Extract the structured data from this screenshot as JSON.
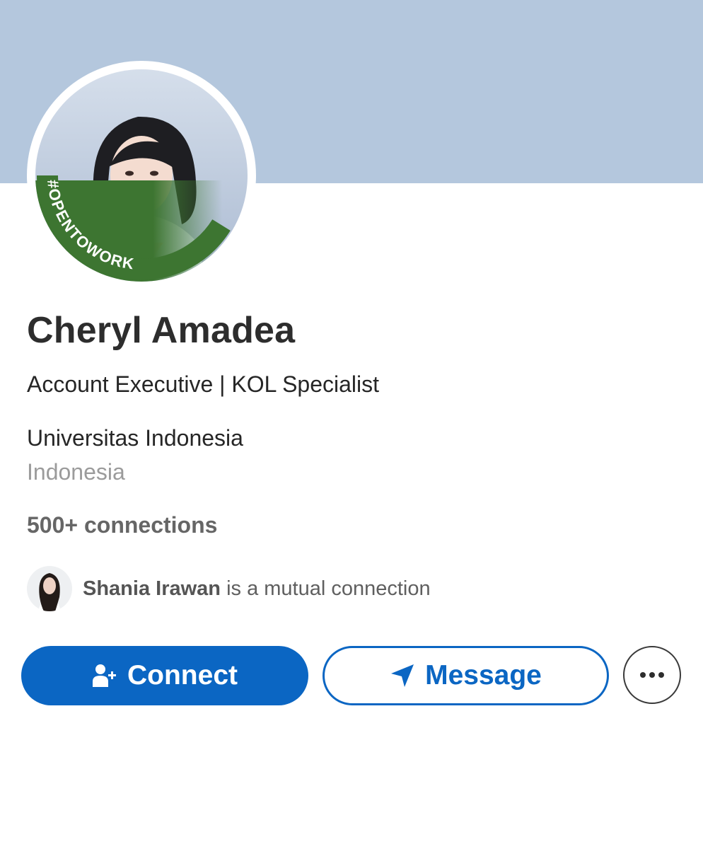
{
  "profile": {
    "name": "Cheryl Amadea",
    "headline": "Account Executive | KOL Specialist",
    "education": "Universitas Indonesia",
    "location": "Indonesia",
    "connections": "500+ connections",
    "badge_text": "#OPENTOWORK"
  },
  "mutual": {
    "name": "Shania Irawan",
    "text": " is a mutual connection"
  },
  "actions": {
    "connect_label": "Connect",
    "message_label": "Message",
    "connect_icon": "add-person-icon",
    "message_icon": "send-icon",
    "more_icon": "more-horizontal-icon"
  },
  "colors": {
    "cover": "#b4c7dd",
    "primary": "#0b66c3",
    "open_to_work_green": "#3d7531"
  }
}
